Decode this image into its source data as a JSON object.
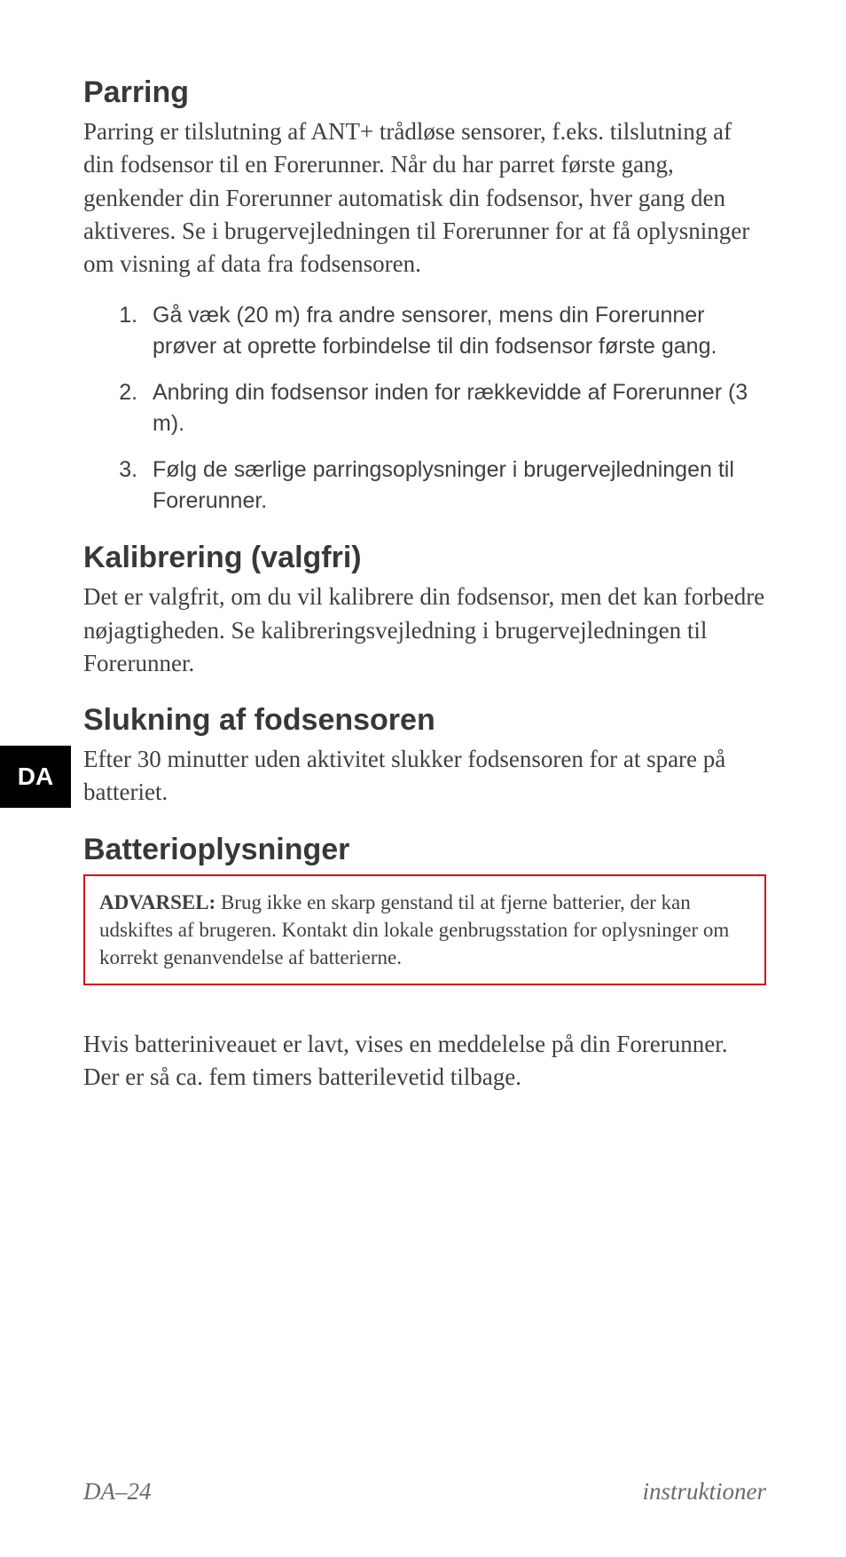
{
  "langTab": "DA",
  "sections": {
    "parring": {
      "heading": "Parring",
      "body": "Parring er tilslutning af ANT+ trådløse sensorer, f.eks. tilslutning af din fodsensor til en Forerunner. Når du har parret første gang, genkender din Forerunner automatisk din fodsensor, hver gang den aktiveres. Se i brugervejledningen til Forerunner for at få oplysninger om visning af data fra fodsensoren.",
      "steps": [
        "Gå væk (20 m) fra andre sensorer, mens din Forerunner prøver at oprette forbindelse til din fodsensor første gang.",
        "Anbring din fodsensor inden for rækkevidde af Forerunner (3 m).",
        "Følg de særlige parringsoplysninger i brugervejledningen til Forerunner."
      ]
    },
    "kalibrering": {
      "heading": "Kalibrering (valgfri)",
      "body": "Det er valgfrit, om du vil kalibrere din fodsensor, men det kan forbedre nøjagtigheden. Se kalibreringsvejledning i brugervejledningen til Forerunner."
    },
    "slukning": {
      "heading": "Slukning af fodsensoren",
      "body": "Efter 30 minutter uden aktivitet slukker fodsensoren for at spare på batteriet."
    },
    "batteri": {
      "heading": "Batterioplysninger",
      "warningLabel": "ADVARSEL:",
      "warningText": " Brug ikke en skarp genstand til at fjerne batterier, der kan udskiftes af brugeren. Kontakt din lokale genbrugsstation for oplysninger om korrekt genanvendelse af batterierne.",
      "body": "Hvis batteriniveauet er lavt, vises en meddelelse på din Forerunner. Der er så ca. fem timers batterilevetid tilbage."
    }
  },
  "footer": {
    "left": "DA–24",
    "right": "instruktioner"
  }
}
